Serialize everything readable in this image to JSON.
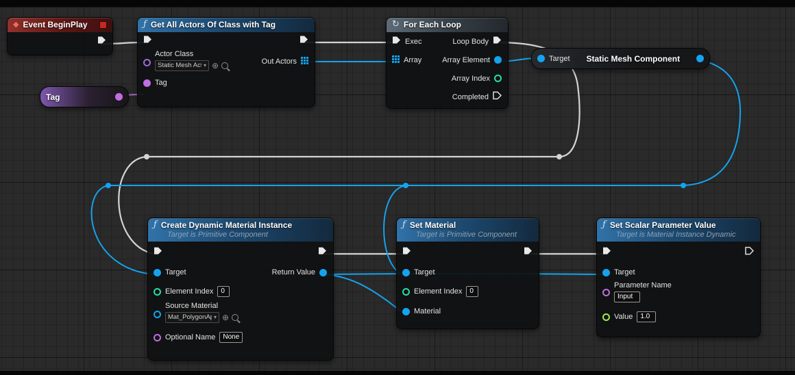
{
  "colors": {
    "exec_pin": "#e8e8e8",
    "wire_exec": "#d4d4d4",
    "wire_object": "#14a3ef",
    "wire_name": "#b06cd8",
    "pin_object": "#14a3ef",
    "pin_class": "#9d6ad8",
    "pin_name": "#c06ee0",
    "pin_int": "#27e0a5",
    "pin_float": "#9fee49",
    "header_function": "#2a6ca3",
    "header_event": "#8e2826",
    "header_macro": "#55606c"
  },
  "event_begin_play": {
    "title": "Event BeginPlay"
  },
  "tag_getter": {
    "title": "Tag"
  },
  "get_all_actors": {
    "title": "Get All Actors Of Class with Tag",
    "actor_class_label": "Actor Class",
    "actor_class_value": "Static Mesh Actor",
    "tag_label": "Tag",
    "out_actors_label": "Out Actors"
  },
  "for_each_loop": {
    "title": "For Each Loop",
    "exec_label": "Exec",
    "array_label": "Array",
    "loop_body_label": "Loop Body",
    "array_element_label": "Array Element",
    "array_index_label": "Array Index",
    "completed_label": "Completed"
  },
  "get_static_mesh": {
    "target_label": "Target",
    "title": "Static Mesh Component"
  },
  "create_dynamic_material_instance": {
    "title": "Create Dynamic Material Instance",
    "subtitle": "Target is Primitive Component",
    "target_label": "Target",
    "element_index_label": "Element Index",
    "element_index_value": "0",
    "source_material_label": "Source Material",
    "source_material_value": "Mat_PolygonApc",
    "optional_name_label": "Optional Name",
    "optional_name_value": "None",
    "return_value_label": "Return Value"
  },
  "set_material": {
    "title": "Set Material",
    "subtitle": "Target is Primitive Component",
    "target_label": "Target",
    "element_index_label": "Element Index",
    "element_index_value": "0",
    "material_label": "Material"
  },
  "set_scalar_parameter_value": {
    "title": "Set Scalar Parameter Value",
    "subtitle": "Target is Material Instance Dynamic",
    "target_label": "Target",
    "parameter_name_label": "Parameter Name",
    "parameter_name_value": "Input",
    "value_label": "Value",
    "value_value": "1.0"
  }
}
